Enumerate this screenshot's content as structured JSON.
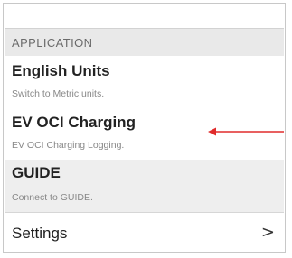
{
  "section": {
    "title": "APPLICATION"
  },
  "items": [
    {
      "title": "English Units",
      "subtitle": "Switch to Metric units."
    },
    {
      "title": "EV OCI Charging",
      "subtitle": "EV OCI Charging Logging."
    },
    {
      "title": "GUIDE",
      "subtitle": "Connect to GUIDE."
    }
  ],
  "settings": {
    "label": "Settings",
    "chevron": ">",
    "icon": "chevron-right-icon"
  },
  "annotation": {
    "arrow_color": "#e02b2b",
    "icon": "red-arrow-icon"
  }
}
